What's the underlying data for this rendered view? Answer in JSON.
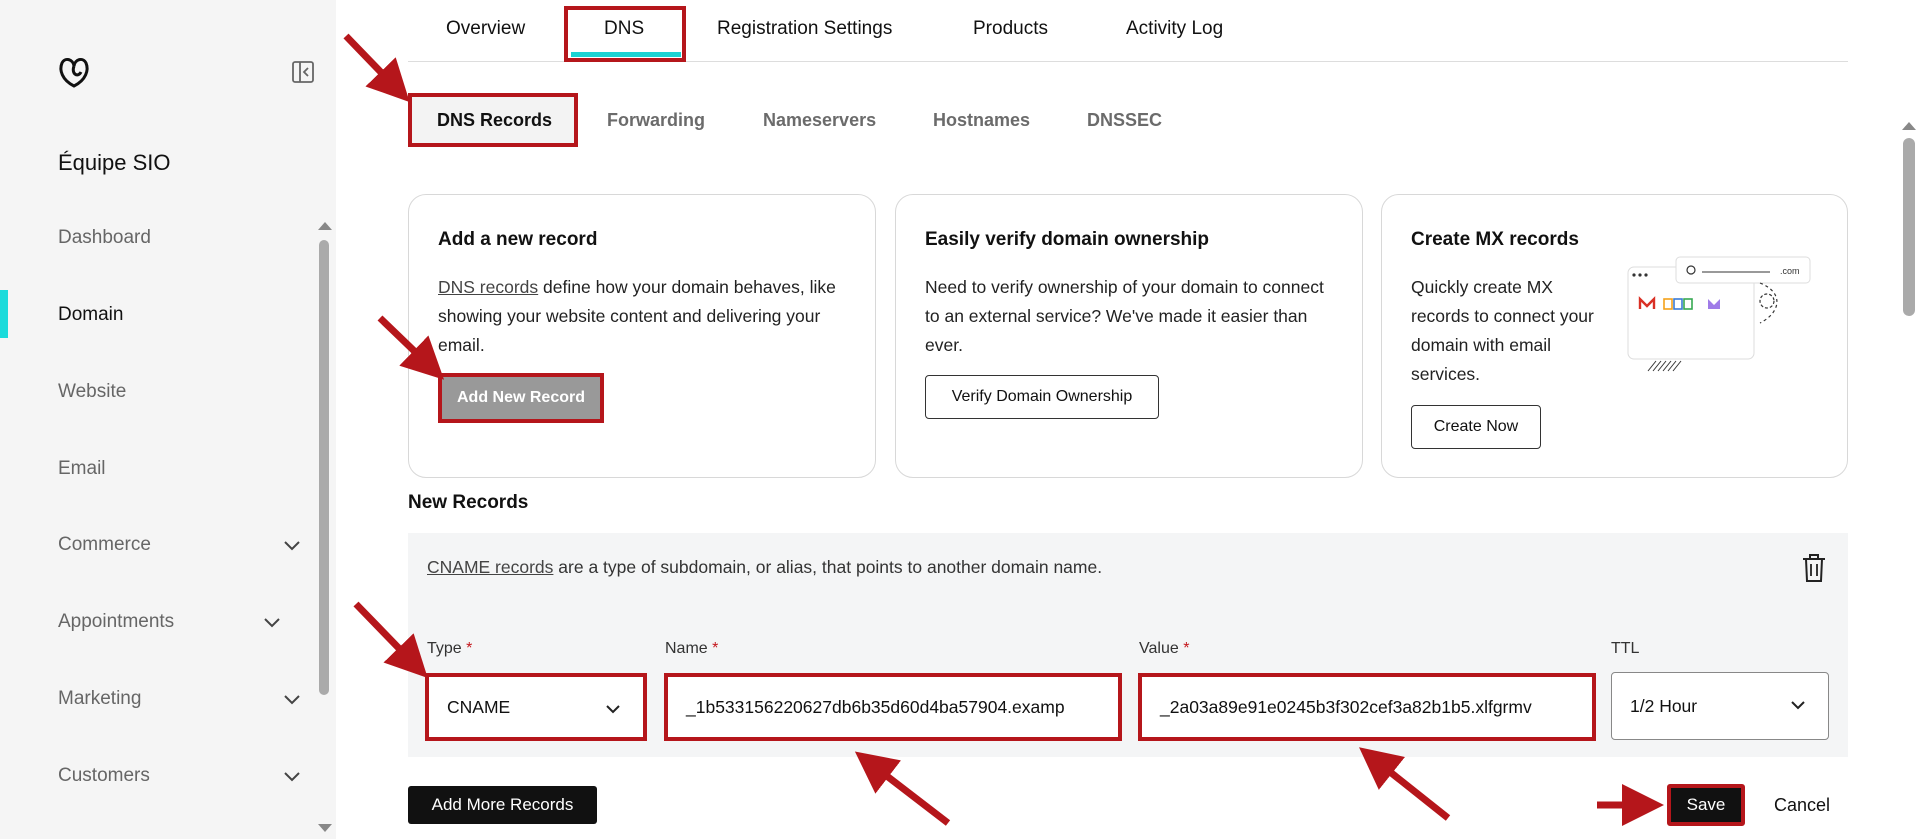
{
  "sidebar": {
    "team_name": "Équipe SIO",
    "items": [
      {
        "label": "Dashboard"
      },
      {
        "label": "Domain"
      },
      {
        "label": "Website"
      },
      {
        "label": "Email"
      },
      {
        "label": "Commerce"
      },
      {
        "label": "Appointments"
      },
      {
        "label": "Marketing"
      },
      {
        "label": "Customers"
      }
    ]
  },
  "tabs": [
    "Overview",
    "DNS",
    "Registration Settings",
    "Products",
    "Activity Log"
  ],
  "subtabs": [
    "DNS Records",
    "Forwarding",
    "Nameservers",
    "Hostnames",
    "DNSSEC"
  ],
  "cards": {
    "add": {
      "title": "Add a new record",
      "link": "DNS records",
      "text": " define how your domain behaves, like showing your website content and delivering your email.",
      "button": "Add New Record"
    },
    "verify": {
      "title": "Easily verify domain ownership",
      "text": "Need to verify ownership of your domain to connect to an external service? We've made it easier than ever.",
      "button": "Verify Domain Ownership"
    },
    "mx": {
      "title": "Create MX records",
      "text": "Quickly create MX records to connect your domain with email services.",
      "button": "Create Now",
      "illustration_text": ".com"
    }
  },
  "new_records": {
    "title": "New Records",
    "desc_link": "CNAME records",
    "desc_text": " are a type of subdomain, or alias, that points to another domain name.",
    "type_label": "Type",
    "name_label": "Name",
    "value_label": "Value",
    "ttl_label": "TTL",
    "required_mark": "*",
    "type_value": "CNAME",
    "name_value": "_1b533156220627db6b35d60d4ba57904.examp",
    "value_value": "_2a03a89e91e0245b3f302cef3a82b1b5.xlfgrmv",
    "ttl_value": "1/2 Hour"
  },
  "actions": {
    "add_more": "Add More Records",
    "save": "Save",
    "cancel": "Cancel"
  },
  "colors": {
    "accent": "#1bdbdb",
    "highlight": "#b5161b"
  }
}
